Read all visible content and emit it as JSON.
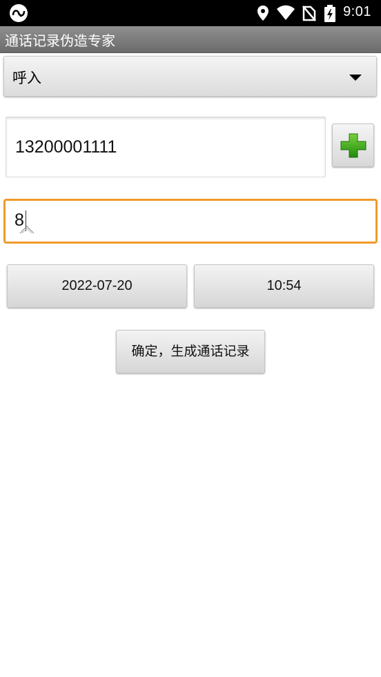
{
  "status_bar": {
    "time": "9:01",
    "icons": [
      "app-notification-icon",
      "location-icon",
      "wifi-icon",
      "no-sim-icon",
      "battery-charging-icon"
    ]
  },
  "app": {
    "title": "通话记录伪造专家"
  },
  "form": {
    "call_type": {
      "selected": "呼入"
    },
    "phone_number": {
      "value": "13200001111"
    },
    "add_contact_icon": "plus-icon",
    "duration": {
      "value": "8"
    },
    "date_button_label": "2022-07-20",
    "time_button_label": "10:54",
    "confirm_button_label": "确定，生成通话记录"
  },
  "colors": {
    "focus_border": "#f09a2a",
    "plus_icon": "#2f9a14",
    "title_bar": "#7d7d7d"
  }
}
